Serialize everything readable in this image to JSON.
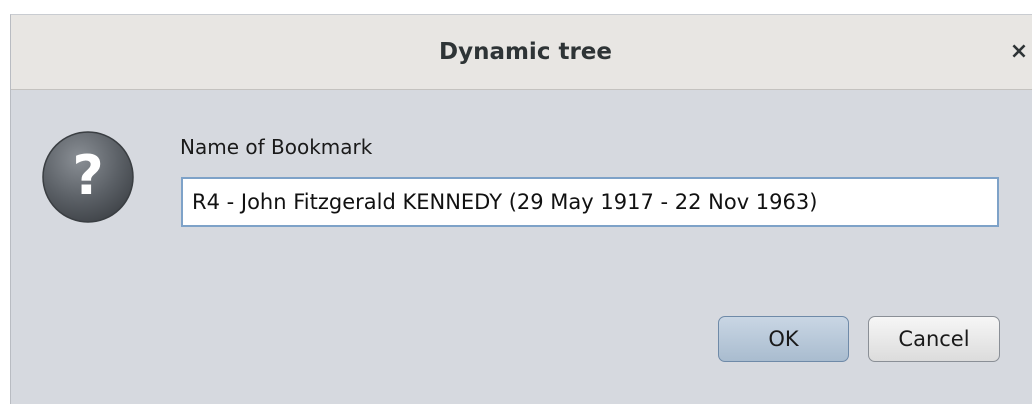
{
  "window": {
    "title": "Dynamic tree",
    "close_label": "×"
  },
  "icon": {
    "name": "question-icon",
    "glyph": "?"
  },
  "form": {
    "label": "Name of Bookmark",
    "value": "R4 - John Fitzgerald KENNEDY (29 May 1917 - 22 Nov 1963)"
  },
  "buttons": {
    "ok": "OK",
    "cancel": "Cancel"
  }
}
